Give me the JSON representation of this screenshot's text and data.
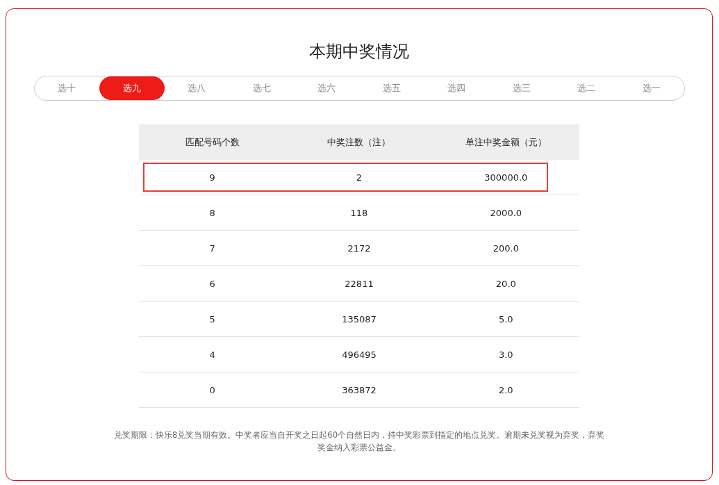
{
  "title": "本期中奖情况",
  "tabs": [
    {
      "label": "选十",
      "selected": false
    },
    {
      "label": "选九",
      "selected": true
    },
    {
      "label": "选八",
      "selected": false
    },
    {
      "label": "选七",
      "selected": false
    },
    {
      "label": "选六",
      "selected": false
    },
    {
      "label": "选五",
      "selected": false
    },
    {
      "label": "选四",
      "selected": false
    },
    {
      "label": "选三",
      "selected": false
    },
    {
      "label": "选二",
      "selected": false
    },
    {
      "label": "选一",
      "selected": false
    }
  ],
  "table": {
    "columns": [
      "匹配号码个数",
      "中奖注数（注）",
      "单注中奖金额（元）"
    ],
    "rows": [
      {
        "cells": [
          "9",
          "2",
          "300000.0"
        ],
        "highlighted": true
      },
      {
        "cells": [
          "8",
          "118",
          "2000.0"
        ],
        "highlighted": false
      },
      {
        "cells": [
          "7",
          "2172",
          "200.0"
        ],
        "highlighted": false
      },
      {
        "cells": [
          "6",
          "22811",
          "20.0"
        ],
        "highlighted": false
      },
      {
        "cells": [
          "5",
          "135087",
          "5.0"
        ],
        "highlighted": false
      },
      {
        "cells": [
          "4",
          "496495",
          "3.0"
        ],
        "highlighted": false
      },
      {
        "cells": [
          "0",
          "363872",
          "2.0"
        ],
        "highlighted": false
      }
    ]
  },
  "note": "兑奖期限：快乐8兑奖当期有效。中奖者应当自开奖之日起60个自然日内，持中奖彩票到指定的地点兑奖。逾期未兑奖视为弃奖，弃奖奖金纳入彩票公益金。"
}
